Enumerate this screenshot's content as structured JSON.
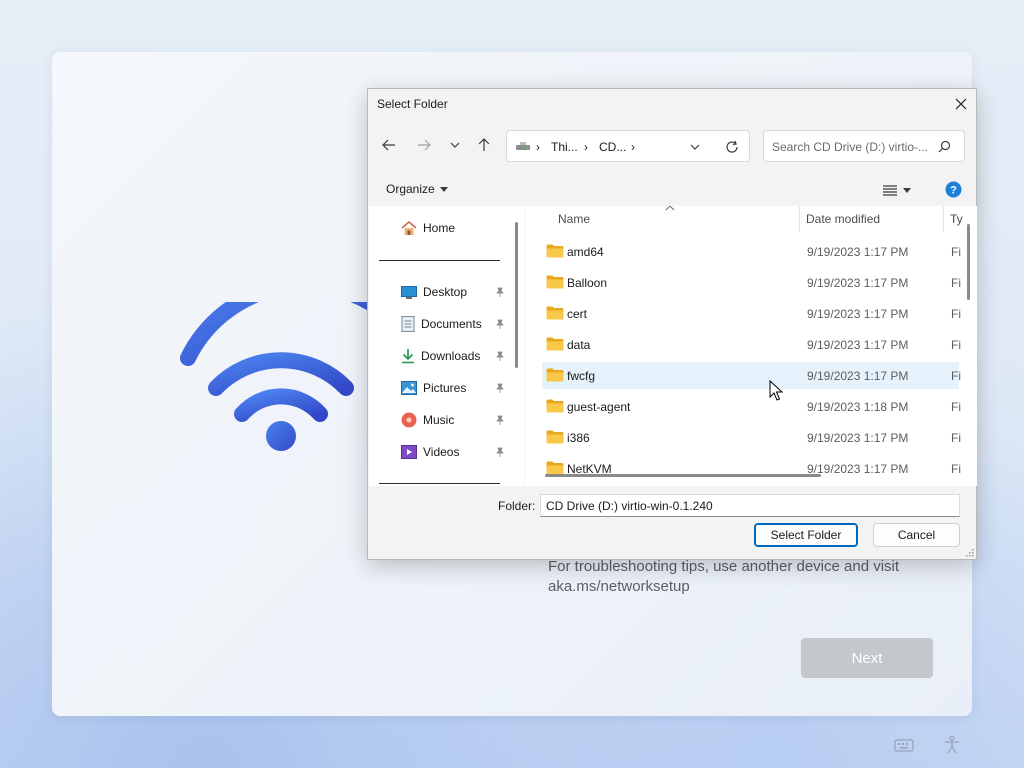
{
  "oobe": {
    "help_text": "For troubleshooting tips, use another device and visit aka.ms/networksetup",
    "next_label": "Next",
    "wifi_icon": "wifi-icon",
    "tray": {
      "keyboard_icon": "keyboard-icon",
      "accessibility_icon": "accessibility-icon"
    }
  },
  "dialog": {
    "title": "Select Folder",
    "address": {
      "segments": [
        "Thi...",
        "CD..."
      ],
      "drive_icon": "drive-icon"
    },
    "search": {
      "placeholder": "Search CD Drive (D:) virtio-..."
    },
    "toolbar": {
      "organize_label": "Organize"
    },
    "nav_pane": {
      "home": "Home",
      "items": [
        {
          "label": "Desktop",
          "icon": "desktop-icon",
          "pinned": true
        },
        {
          "label": "Documents",
          "icon": "documents-icon",
          "pinned": true
        },
        {
          "label": "Downloads",
          "icon": "downloads-icon",
          "pinned": true
        },
        {
          "label": "Pictures",
          "icon": "pictures-icon",
          "pinned": true
        },
        {
          "label": "Music",
          "icon": "music-icon",
          "pinned": true
        },
        {
          "label": "Videos",
          "icon": "videos-icon",
          "pinned": true
        }
      ]
    },
    "file_list": {
      "columns": [
        "Name",
        "Date modified",
        "Ty"
      ],
      "rows": [
        {
          "name": "amd64",
          "date": "9/19/2023 1:17 PM",
          "type": "Fi"
        },
        {
          "name": "Balloon",
          "date": "9/19/2023 1:17 PM",
          "type": "Fi"
        },
        {
          "name": "cert",
          "date": "9/19/2023 1:17 PM",
          "type": "Fi"
        },
        {
          "name": "data",
          "date": "9/19/2023 1:17 PM",
          "type": "Fi"
        },
        {
          "name": "fwcfg",
          "date": "9/19/2023 1:17 PM",
          "type": "Fi",
          "hover": true
        },
        {
          "name": "guest-agent",
          "date": "9/19/2023 1:18 PM",
          "type": "Fi"
        },
        {
          "name": "i386",
          "date": "9/19/2023 1:17 PM",
          "type": "Fi"
        },
        {
          "name": "NetKVM",
          "date": "9/19/2023 1:17 PM",
          "type": "Fi"
        }
      ]
    },
    "folder_label": "Folder:",
    "folder_value": "CD Drive (D:) virtio-win-0.1.240",
    "select_label": "Select Folder",
    "cancel_label": "Cancel"
  },
  "colors": {
    "accent": "#0067c0",
    "folder": "#f5c23e",
    "wifi": "#3e64d8"
  }
}
